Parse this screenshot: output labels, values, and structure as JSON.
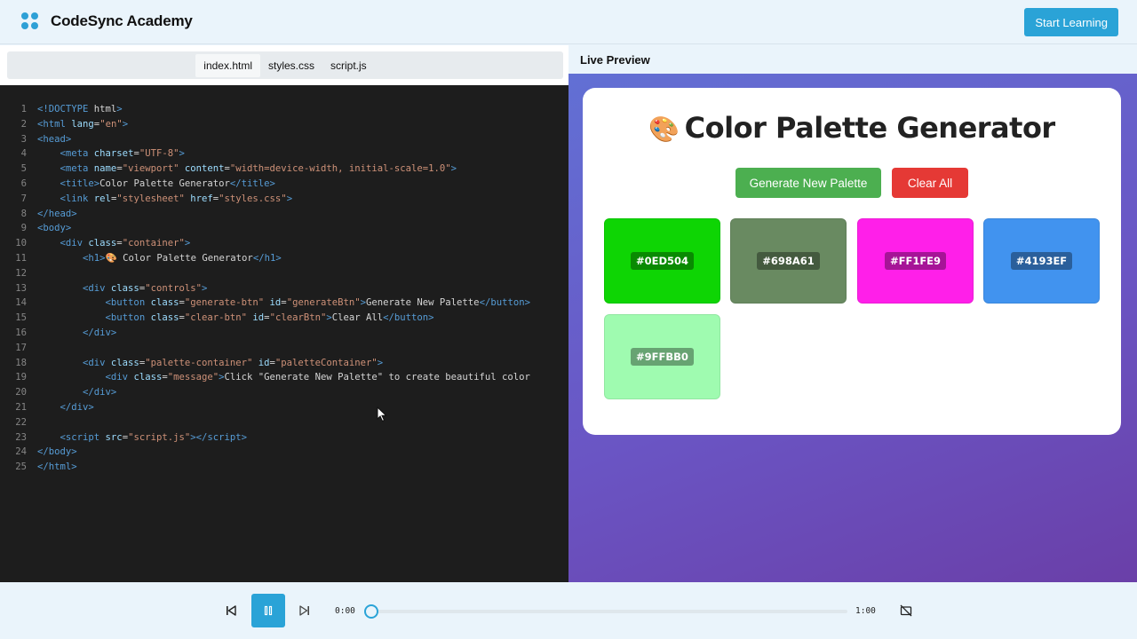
{
  "header": {
    "brand": "CodeSync Academy",
    "cta_label": "Start Learning"
  },
  "editor": {
    "tabs": [
      {
        "label": "index.html",
        "active": true
      },
      {
        "label": "styles.css",
        "active": false
      },
      {
        "label": "script.js",
        "active": false
      }
    ]
  },
  "preview": {
    "title": "Live Preview",
    "app_title": "Color Palette Generator",
    "emoji": "🎨",
    "generate_label": "Generate New Palette",
    "clear_label": "Clear All",
    "swatches": [
      {
        "hex": "#0ED504",
        "color": "#0ED504"
      },
      {
        "hex": "#698A61",
        "color": "#698A61"
      },
      {
        "hex": "#FF1FE9",
        "color": "#FF1FE9"
      },
      {
        "hex": "#4193EF",
        "color": "#4193EF"
      },
      {
        "hex": "#9FFBB0",
        "color": "#9FFBB0"
      }
    ]
  },
  "player": {
    "current_time": "0:00",
    "duration": "1:00",
    "progress": 0
  },
  "colors": {
    "accent": "#2aa3d7",
    "editor_bg": "#1d1d1d",
    "generate_btn": "#4caf50",
    "clear_btn": "#e53935"
  }
}
